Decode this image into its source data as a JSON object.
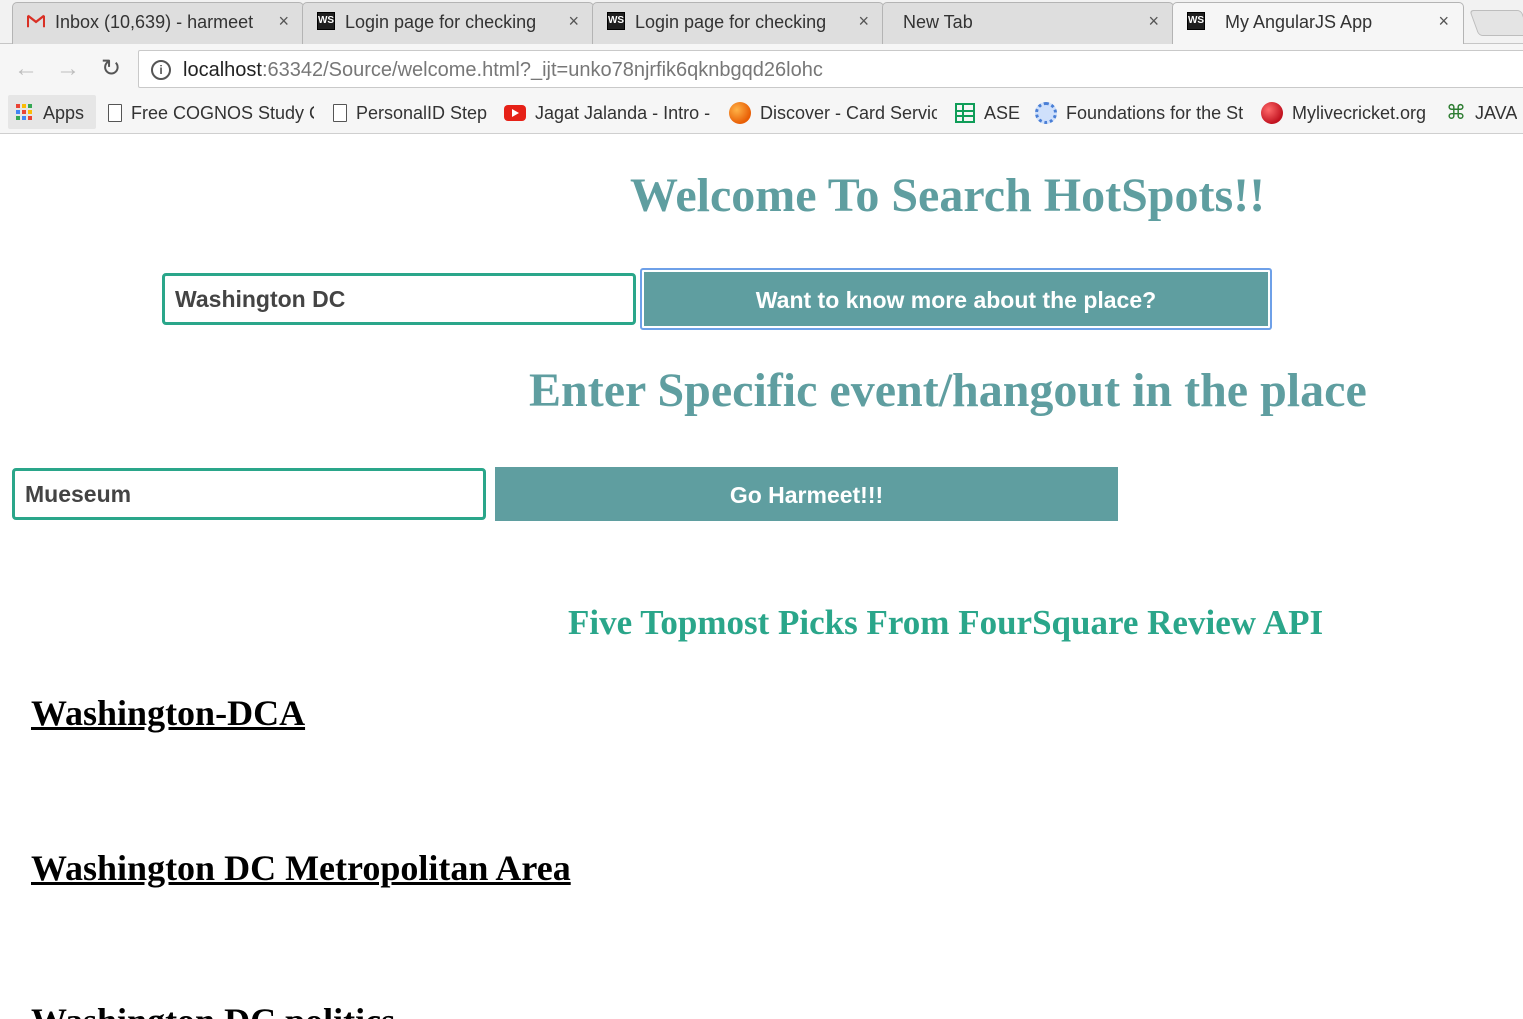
{
  "browser": {
    "tabs": [
      {
        "title": "Inbox (10,639) - harmeet",
        "icon": "gmail-icon",
        "active": false
      },
      {
        "title": "Login page for checking",
        "icon": "ws-icon",
        "active": false
      },
      {
        "title": "Login page for checking",
        "icon": "ws-icon",
        "active": false
      },
      {
        "title": "New Tab",
        "icon": "none",
        "active": false
      },
      {
        "title": "My AngularJS App",
        "icon": "ws-icon",
        "active": true
      }
    ],
    "ws_label": "WS",
    "close_glyph": "×",
    "url": {
      "host": "localhost",
      "rest": ":63342/Source/welcome.html?_ijt=unko78njrfik6qknbgqd26lohc"
    },
    "bookmarks": [
      {
        "label": "Apps",
        "icon": "apps-grid-icon"
      },
      {
        "label": "Free COGNOS Study C",
        "icon": "page-icon"
      },
      {
        "label": "PersonalID Step",
        "icon": "page-icon"
      },
      {
        "label": "Jagat Jalanda - Intro -",
        "icon": "youtube-icon"
      },
      {
        "label": "Discover - Card Servic",
        "icon": "discover-icon"
      },
      {
        "label": "ASE",
        "icon": "sheets-icon"
      },
      {
        "label": "Foundations for the St",
        "icon": "foundations-icon"
      },
      {
        "label": "Mylivecricket.org",
        "icon": "cricket-icon"
      },
      {
        "label": "JAVA",
        "icon": "java-icon"
      }
    ]
  },
  "page": {
    "welcome_title": "Welcome To Search HotSpots!!",
    "place_input_value": "Washington DC",
    "know_more_button": "Want to know more about the place?",
    "event_title": "Enter Specific event/hangout in the place",
    "event_input_value": "Mueseum",
    "go_button": "Go Harmeet!!!",
    "picks_title": "Five Topmost Picks From FourSquare Review API",
    "results": [
      "Washington-DCA",
      "Washington DC Metropolitan Area",
      "Washington DC politics"
    ]
  },
  "colors": {
    "teal": "#5f9ea0",
    "green_teal": "#2aa68a",
    "button_focus_outline": "#6ea0e8"
  }
}
